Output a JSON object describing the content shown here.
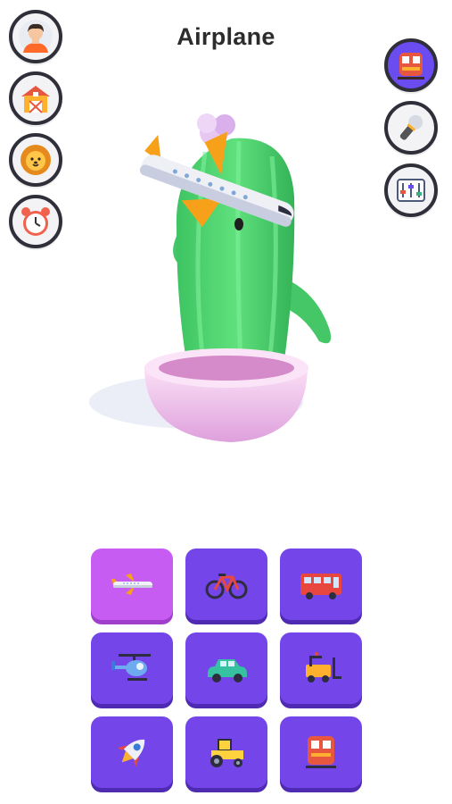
{
  "title": "Airplane",
  "left_menu": [
    {
      "icon": "person-icon"
    },
    {
      "icon": "barn-icon"
    },
    {
      "icon": "lion-icon"
    },
    {
      "icon": "alarm-clock-icon"
    }
  ],
  "right_menu": [
    {
      "icon": "train-icon",
      "active": true
    },
    {
      "icon": "microphone-icon",
      "active": false
    },
    {
      "icon": "mixer-icon",
      "active": false
    }
  ],
  "tiles": [
    {
      "icon": "airplane-icon",
      "selected": true
    },
    {
      "icon": "bicycle-icon",
      "selected": false
    },
    {
      "icon": "bus-icon",
      "selected": false
    },
    {
      "icon": "helicopter-icon",
      "selected": false
    },
    {
      "icon": "car-icon",
      "selected": false
    },
    {
      "icon": "forklift-icon",
      "selected": false
    },
    {
      "icon": "rocket-icon",
      "selected": false
    },
    {
      "icon": "tractor-icon",
      "selected": false
    },
    {
      "icon": "train-icon",
      "selected": false
    }
  ],
  "colors": {
    "tile": "#7446ea",
    "tile_selected": "#c75cf2",
    "active_circle": "#6a4cf0",
    "cactus": "#4fd06f",
    "pot": "#f3c6f0"
  }
}
